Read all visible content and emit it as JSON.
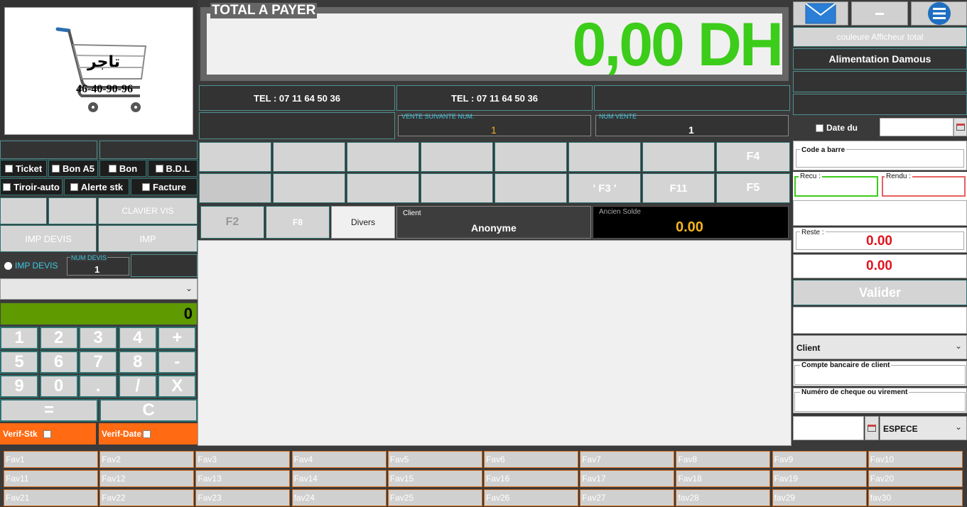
{
  "logo": {
    "text_ar": "تاجر",
    "phone": "46-40-90-96"
  },
  "total": {
    "label": "TOTAL A PAYER",
    "amount": "0,00 DH"
  },
  "info": {
    "tel1": "TEL : 07 11 64 50 36",
    "tel2": "TEL : 07 11 64 50 36",
    "next_sale_label": "VENTE SUIVANTE NUM:",
    "next_sale_value": "1",
    "sale_num_label": "NUM VENTE",
    "sale_num_value": "1"
  },
  "doc_types": {
    "ticket": "Ticket",
    "bon_a5": "Bon A5",
    "bon": "Bon",
    "bdl": "B.D.L",
    "tiroir": "Tiroir-auto",
    "alerte": "Alerte stk",
    "facture": "Facture"
  },
  "left": {
    "clavier_vis": "CLAVIER VIS",
    "imp_devis": "IMP DEVIS",
    "imp": "IMP",
    "imp_devis_radio": "IMP DEVIS",
    "num_devis_label": "NUM DEVIS",
    "num_devis_value": "1",
    "display_value": "0",
    "verif_stk": "Verif-Stk",
    "verif_date": "Verif-Date"
  },
  "keypad": [
    "1",
    "2",
    "3",
    "4",
    "+",
    "5",
    "6",
    "7",
    "8",
    "-",
    "9",
    "0",
    ".",
    "/",
    "X"
  ],
  "keypad_equal": "=",
  "keypad_clear": "C",
  "fkeys": {
    "f4": "F4",
    "f3": "' F3 '",
    "f11": "F11",
    "f5": "F5",
    "f2": "F2",
    "f8": "F8",
    "divers": "Divers"
  },
  "client": {
    "label": "Client",
    "value": "Anonyme",
    "old_balance_label": "Ancien Solde",
    "old_balance_value": "0.00"
  },
  "right": {
    "color_btn": "couleure Afficheur total",
    "shop_name": "Alimentation Damous",
    "date_label": "Date du",
    "barcode_label": "Code a barre",
    "recu_label": "Recu :",
    "rendu_label": "Rendu :",
    "reste_label": "Reste :",
    "reste_value": "0.00",
    "extra_value": "0.00",
    "valider": "Valider",
    "client_select": "Client",
    "bank_label": "Compte bancaire de client",
    "cheque_label": "Numéro de cheque ou virement",
    "payment": "ESPECE"
  },
  "favs": [
    "Fav1",
    "Fav2",
    "Fav3",
    "Fav4",
    "Fav5",
    "Fav6",
    "Fav7",
    "Fav8",
    "Fav9",
    "Fav10",
    "Fav11",
    "Fav12",
    "Fav13",
    "Fav14",
    "Fav15",
    "Fav16",
    "Fav17",
    "Fav18",
    "Fav19",
    "Fav20",
    "Fav21",
    "Fav22",
    "Fav23",
    "fav24",
    "Fav25",
    "Fav26",
    "Fav27",
    "fav28",
    "fav29",
    "fav30"
  ],
  "colors": {
    "accent_teal": "#2e7272",
    "total_green": "#3ccc1a",
    "orange": "#ff6a13",
    "red": "#e0141e",
    "gold": "#f5b51c",
    "display_green": "#5e9a00"
  }
}
